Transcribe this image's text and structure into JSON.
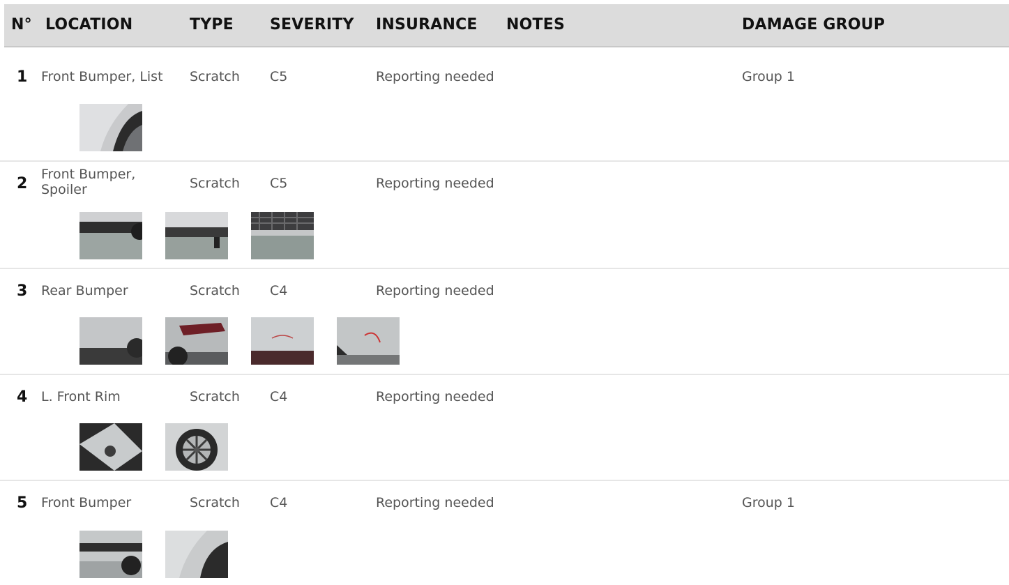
{
  "header": {
    "no": "N°",
    "location": "LOCATION",
    "type": "TYPE",
    "severity": "SEVERITY",
    "insurance": "INSURANCE",
    "notes": "NOTES",
    "damage_group": "DAMAGE GROUP"
  },
  "rows": [
    {
      "no": "1",
      "location": "Front Bumper, List",
      "type": "Scratch",
      "severity": "C5",
      "insurance": "Reporting needed",
      "notes": "",
      "group": "Group 1",
      "photos": 1
    },
    {
      "no": "2",
      "location": "Front Bumper, Spoiler",
      "type": "Scratch",
      "severity": "C5",
      "insurance": "Reporting needed",
      "notes": "",
      "group": "",
      "photos": 3
    },
    {
      "no": "3",
      "location": "Rear Bumper",
      "type": "Scratch",
      "severity": "C4",
      "insurance": "Reporting needed",
      "notes": "",
      "group": "",
      "photos": 4
    },
    {
      "no": "4",
      "location": "L. Front Rim",
      "type": "Scratch",
      "severity": "C4",
      "insurance": "Reporting needed",
      "notes": "",
      "group": "",
      "photos": 2
    },
    {
      "no": "5",
      "location": "Front Bumper",
      "type": "Scratch",
      "severity": "C4",
      "insurance": "Reporting needed",
      "notes": "",
      "group": "Group 1",
      "photos": 2
    }
  ]
}
